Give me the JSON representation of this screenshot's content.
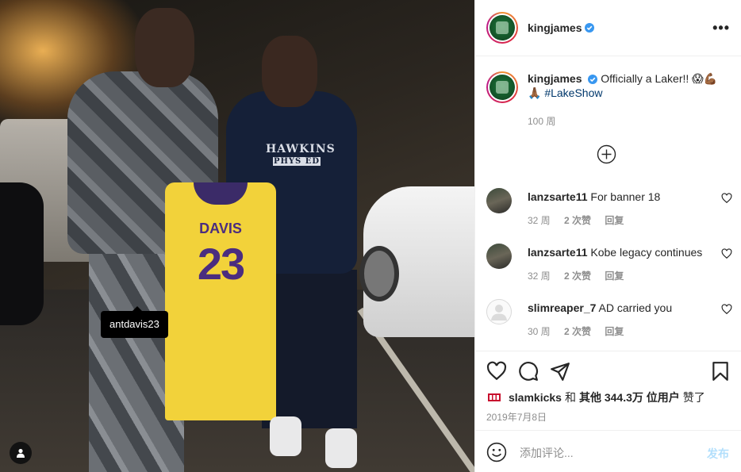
{
  "photo": {
    "tag_username": "antdavis23",
    "jersey_name": "DAVIS",
    "jersey_number": "23",
    "hoodie_line1": "HAWKINS",
    "hoodie_line2": "PHYS ED"
  },
  "header": {
    "username": "kingjames",
    "more_icon": "ellipsis-icon"
  },
  "caption": {
    "username": "kingjames",
    "text": "Officially a Laker!! 😱💪🏾",
    "text2": "🙏🏾",
    "hashtag": "#LakeShow",
    "time": "100 周"
  },
  "comments": [
    {
      "username": "lanzsarte11",
      "text": "For banner 18",
      "time": "32 周",
      "likes": "2 次赞",
      "reply": "回复"
    },
    {
      "username": "lanzsarte11",
      "text": "Kobe legacy continues",
      "time": "32 周",
      "likes": "2 次赞",
      "reply": "回复"
    },
    {
      "username": "slimreaper_7",
      "text": "AD carried you",
      "time": "30 周",
      "likes": "2 次赞",
      "reply": "回复"
    }
  ],
  "likes": {
    "user": "slamkicks",
    "connector": "和",
    "others": "其他 344.3万 位用户",
    "suffix": "赞了"
  },
  "date": "2019年7月8日",
  "add_comment": {
    "placeholder": "添加评论...",
    "post_label": "发布"
  },
  "colors": {
    "verified": "#3897f0",
    "link": "#00376b",
    "post_disabled": "#b2dffc",
    "secondary_text": "#8e8e8e"
  }
}
